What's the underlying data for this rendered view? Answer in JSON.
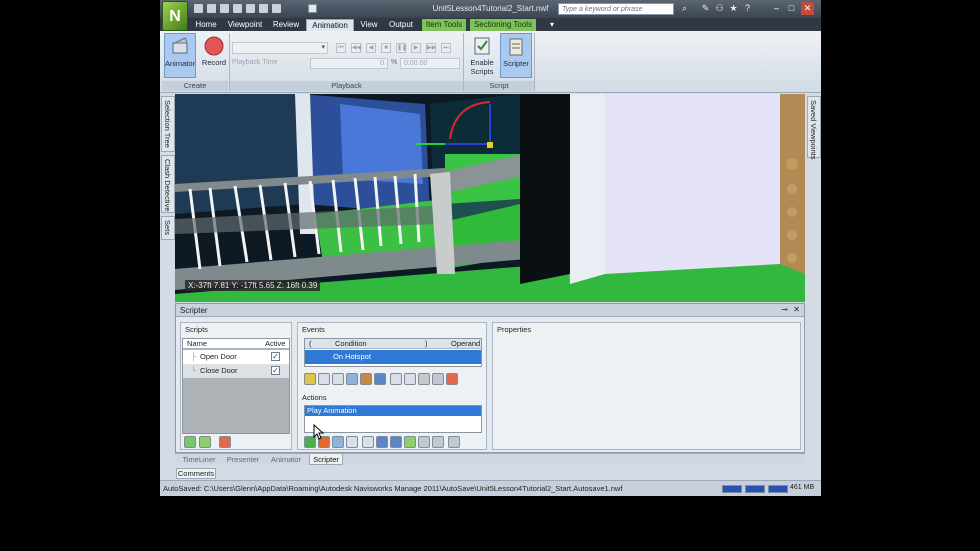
{
  "window": {
    "title": "Unit5Lesson4Tutorial2_Start.nwf",
    "search_placeholder": "Type a keyword or phrase",
    "logo_letter": "N"
  },
  "tabs": [
    {
      "label": "Home"
    },
    {
      "label": "Viewpoint"
    },
    {
      "label": "Review"
    },
    {
      "label": "Animation"
    },
    {
      "label": "View"
    },
    {
      "label": "Output"
    },
    {
      "label": "Item Tools"
    },
    {
      "label": "Sectioning Tools"
    }
  ],
  "ribbon": {
    "create": {
      "label": "Create",
      "animator": "Animator",
      "record": "Record"
    },
    "playback": {
      "label": "Playback",
      "time_label": "Playback Time",
      "position": "0",
      "percent_symbol": "%",
      "time": "0:00.00"
    },
    "script": {
      "label": "Script",
      "enable_scripts_line1": "Enable",
      "enable_scripts_line2": "Scripts",
      "scripter": "Scripter"
    }
  },
  "viewport": {
    "coord_readout": "X:-37ft 7.81  Y: -17ft 5.65  Z: 16ft 0.39"
  },
  "left_dock": [
    "Selection Tree",
    "Clash Detective",
    "Sets"
  ],
  "right_dock": [
    "Saved Viewpoints"
  ],
  "scripter": {
    "title": "Scripter",
    "scripts_pane": {
      "title": "Scripts",
      "col_name": "Name",
      "col_active": "Active",
      "rows": [
        {
          "name": "Open Door",
          "active": true
        },
        {
          "name": "Close Door",
          "active": true
        }
      ]
    },
    "events_pane": {
      "title": "Events",
      "col_open": "(",
      "col_condition": "Condition",
      "col_close": ")",
      "col_operand": "Operand",
      "rows": [
        {
          "condition": "On Hotspot"
        }
      ]
    },
    "actions_pane": {
      "title": "Actions",
      "rows": [
        {
          "label": "Play Animation"
        }
      ]
    },
    "properties_pane": {
      "title": "Properties"
    }
  },
  "bottom_tabs": [
    {
      "label": "TimeLiner"
    },
    {
      "label": "Presenter"
    },
    {
      "label": "Animator"
    },
    {
      "label": "Scripter"
    }
  ],
  "comments_tab": "Comments",
  "status": {
    "text": "AutoSaved: C:\\Users\\Glenn\\AppData\\Roaming\\Autodesk Navisworks Manage 2011\\AutoSave\\Unit5Lesson4Tutorial2_Start.Autosave1.nwf",
    "memory": "461 MB"
  },
  "colors": {
    "accent": "#7fc25a",
    "selection": "#2f79d6",
    "record": "#e05555"
  }
}
